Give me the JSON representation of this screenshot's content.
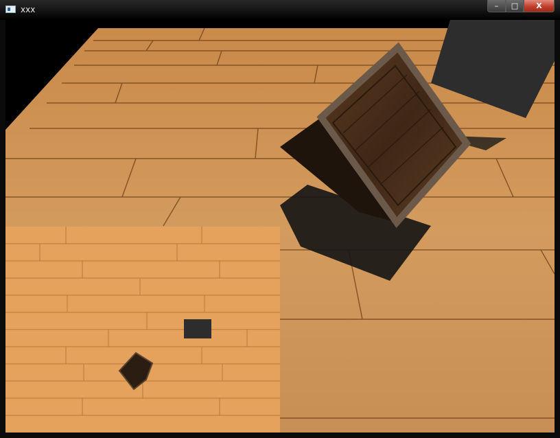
{
  "window": {
    "title": "xxx",
    "controls": {
      "minimize": "–",
      "maximize": "□",
      "close": "X"
    }
  },
  "scene": {
    "floor_color": "#c98a4a",
    "crate_color": "#4a3020",
    "block_color": "#2d2d2d",
    "shadow_color": "#111111"
  },
  "minimap": {
    "floor_color": "#e6a45f",
    "block_color": "#2d2d2d"
  }
}
